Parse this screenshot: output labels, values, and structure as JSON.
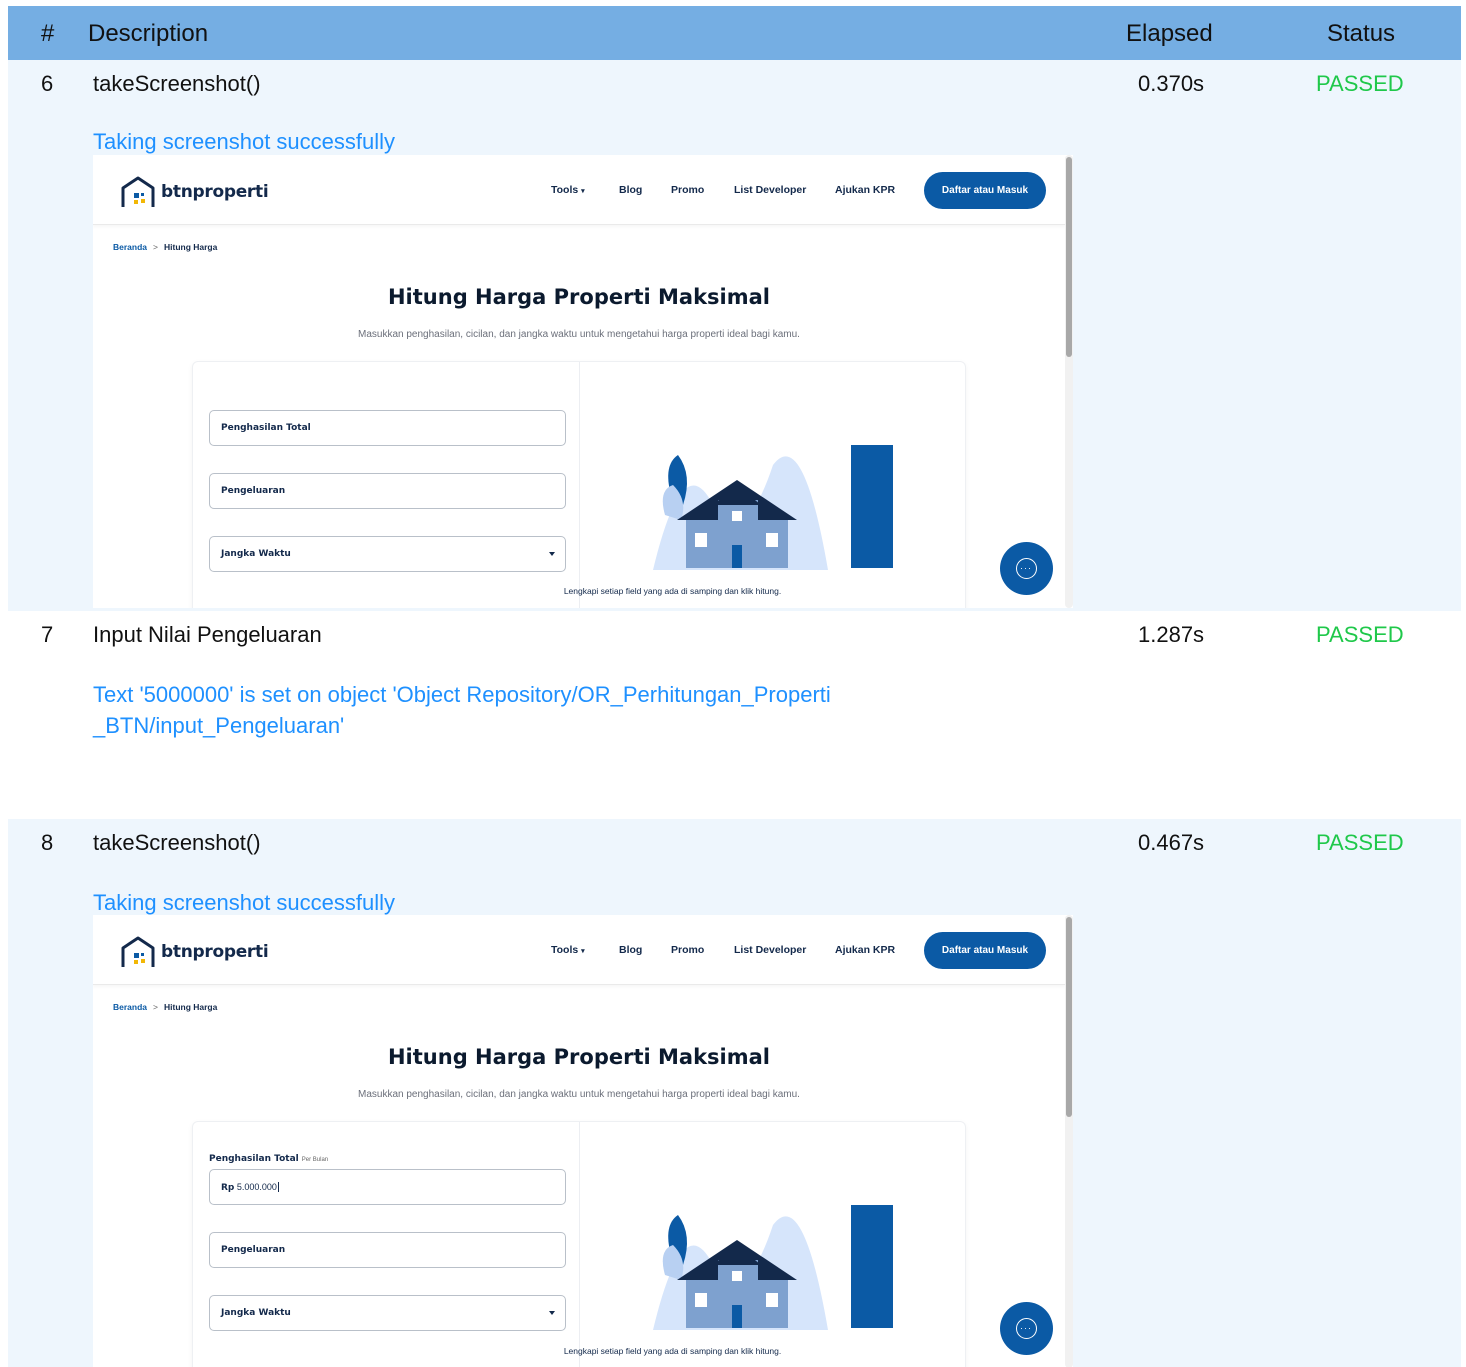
{
  "header": {
    "num": "#",
    "description": "Description",
    "elapsed": "Elapsed",
    "status": "Status"
  },
  "rows": [
    {
      "num": "6",
      "description": "takeScreenshot()",
      "elapsed": "0.370s",
      "status": "PASSED",
      "message": "Taking screenshot successfully"
    },
    {
      "num": "7",
      "description": "Input Nilai Pengeluaran",
      "elapsed": "1.287s",
      "status": "PASSED",
      "message_line1": "Text '5000000' is set on object 'Object Repository/OR_Perhitungan_Properti",
      "message_line2": "_BTN/input_Pengeluaran'"
    },
    {
      "num": "8",
      "description": "takeScreenshot()",
      "elapsed": "0.467s",
      "status": "PASSED",
      "message": "Taking screenshot successfully"
    }
  ],
  "site": {
    "logo": "btnproperti",
    "nav": {
      "tools": "Tools",
      "blog": "Blog",
      "promo": "Promo",
      "list_developer": "List Developer",
      "ajukan_kpr": "Ajukan KPR",
      "cta": "Daftar atau Masuk"
    },
    "breadcrumb": {
      "home": "Beranda",
      "separator": ">",
      "current": "Hitung Harga"
    },
    "title": "Hitung Harga Properti Maksimal",
    "subtitle": "Masukkan penghasilan, cicilan, dan jangka waktu untuk mengetahui harga properti ideal bagi kamu.",
    "fields": {
      "income": "Penghasilan Total",
      "income_suffix": "Per Bulan",
      "income_prefix": "Rp",
      "income_value": "5.000.000",
      "expense": "Pengeluaran",
      "term": "Jangka Waktu"
    },
    "illustration_caption": "Lengkapi setiap field yang ada di samping dan klik hitung.",
    "colors": {
      "primary": "#0b5aa5",
      "navy": "#13294b",
      "passed": "#1fc84a",
      "message": "#1e90ff",
      "header_bg": "#75aee3",
      "row_bg": "#eef6fd"
    }
  }
}
